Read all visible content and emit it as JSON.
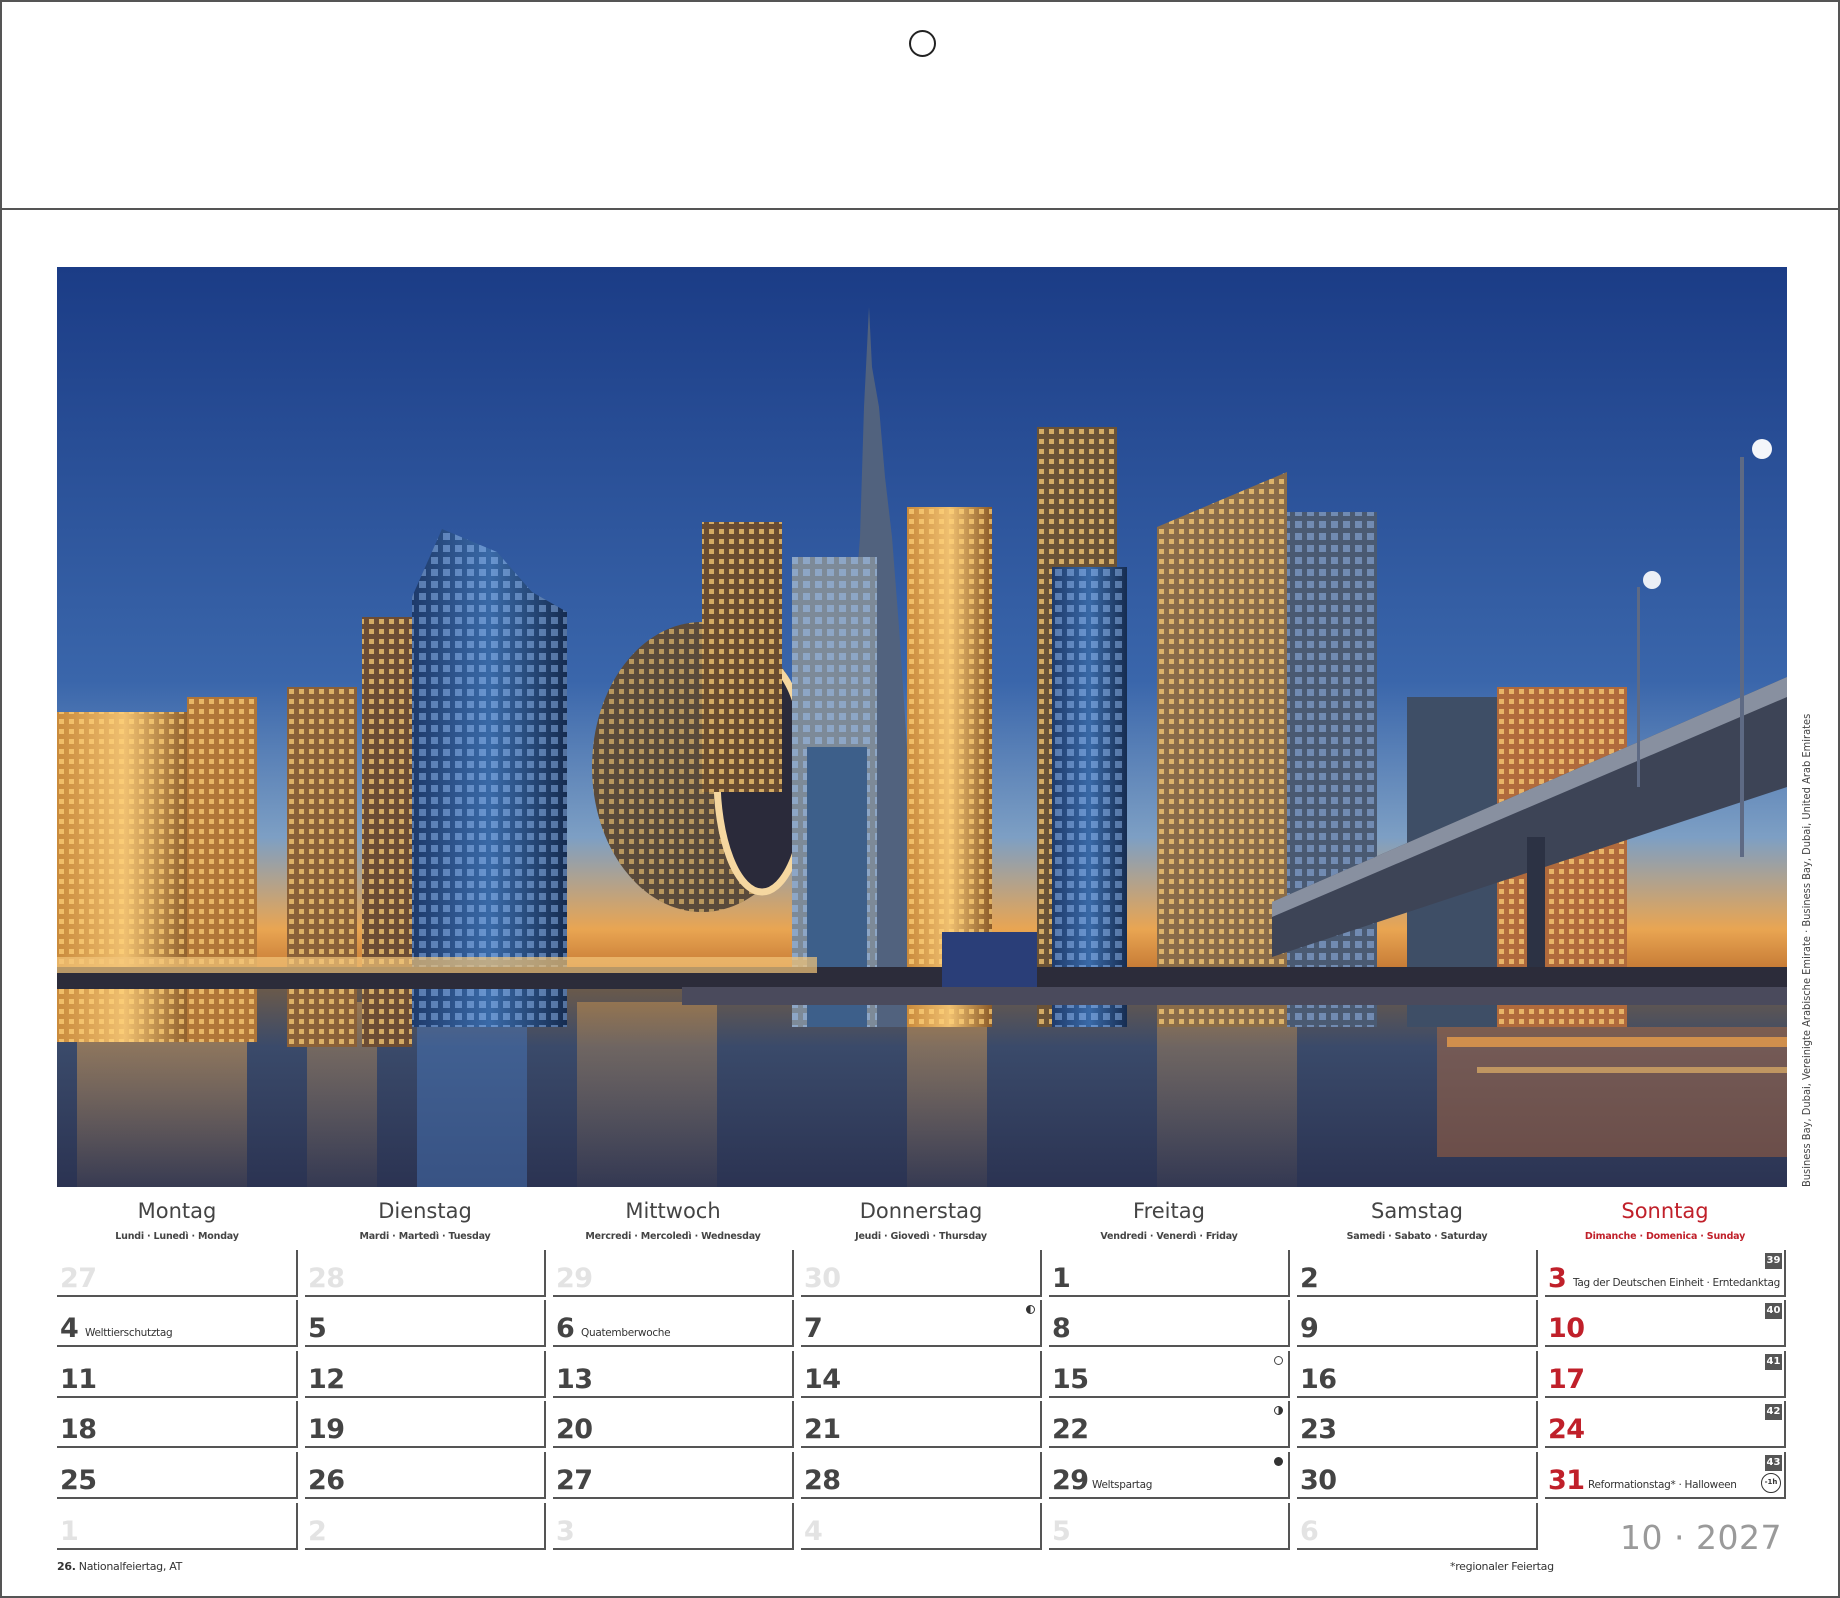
{
  "photo": {
    "caption": "Business Bay, Dubai, Vereinigte Arabische Emirate · Business Bay, Dubai, United Arab Emirates"
  },
  "weekdays": [
    {
      "name": "Montag",
      "sub": "Lundi · Lunedì · Monday"
    },
    {
      "name": "Dienstag",
      "sub": "Mardi · Martedì · Tuesday"
    },
    {
      "name": "Mittwoch",
      "sub": "Mercredi · Mercoledì · Wednesday"
    },
    {
      "name": "Donnerstag",
      "sub": "Jeudi · Giovedì · Thursday"
    },
    {
      "name": "Freitag",
      "sub": "Vendredi · Venerdì · Friday"
    },
    {
      "name": "Samstag",
      "sub": "Samedi · Sabato · Saturday"
    },
    {
      "name": "Sonntag",
      "sub": "Dimanche · Domenica · Sunday"
    }
  ],
  "weeks": [
    {
      "week_no": "39",
      "days": [
        {
          "num": "27",
          "other": true
        },
        {
          "num": "28",
          "other": true
        },
        {
          "num": "29",
          "other": true
        },
        {
          "num": "30",
          "other": true
        },
        {
          "num": "1"
        },
        {
          "num": "2"
        },
        {
          "num": "3",
          "note": "Tag der Deutschen Einheit  ·  Erntedanktag"
        }
      ]
    },
    {
      "week_no": "40",
      "days": [
        {
          "num": "4",
          "note": "Welttierschutztag"
        },
        {
          "num": "5"
        },
        {
          "num": "6",
          "note": "Quatemberwoche"
        },
        {
          "num": "7",
          "moon": "half-l"
        },
        {
          "num": "8"
        },
        {
          "num": "9"
        },
        {
          "num": "10"
        }
      ]
    },
    {
      "week_no": "41",
      "days": [
        {
          "num": "11"
        },
        {
          "num": "12"
        },
        {
          "num": "13"
        },
        {
          "num": "14"
        },
        {
          "num": "15",
          "moon": "full"
        },
        {
          "num": "16"
        },
        {
          "num": "17"
        }
      ]
    },
    {
      "week_no": "42",
      "days": [
        {
          "num": "18"
        },
        {
          "num": "19"
        },
        {
          "num": "20"
        },
        {
          "num": "21"
        },
        {
          "num": "22",
          "moon": "half-r"
        },
        {
          "num": "23"
        },
        {
          "num": "24"
        }
      ]
    },
    {
      "week_no": "43",
      "days": [
        {
          "num": "25"
        },
        {
          "num": "26"
        },
        {
          "num": "27"
        },
        {
          "num": "28"
        },
        {
          "num": "29",
          "note": "Weltspartag",
          "moon": "new"
        },
        {
          "num": "30"
        },
        {
          "num": "31",
          "note": "Reformationstag*  ·  Halloween",
          "clock": "-1h"
        }
      ]
    },
    {
      "week_no": "",
      "days": [
        {
          "num": "1",
          "other": true
        },
        {
          "num": "2",
          "other": true
        },
        {
          "num": "3",
          "other": true
        },
        {
          "num": "4",
          "other": true
        },
        {
          "num": "5",
          "other": true
        },
        {
          "num": "6",
          "other": true
        }
      ]
    }
  ],
  "footnote_left_bold": "26.",
  "footnote_left_text": " Nationalfeiertag, AT",
  "footnote_right": "*regionaler Feiertag",
  "month_year": "10 · 2027",
  "colors": {
    "sunday_red": "#c0202a",
    "text_dark": "#444444",
    "other_month": "#e3e3e3",
    "sky_top": "#1b3c86",
    "sky_horizon": "#e9a552"
  }
}
